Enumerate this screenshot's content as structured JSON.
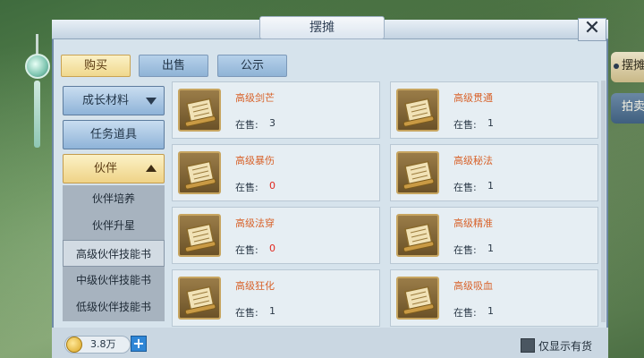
{
  "window": {
    "title": "摆摊",
    "close_symbol": "✕"
  },
  "tabs": [
    {
      "label": "购买",
      "active": true
    },
    {
      "label": "出售",
      "active": false
    },
    {
      "label": "公示",
      "active": false
    }
  ],
  "categories": [
    {
      "label": "成长材料",
      "expanded": false
    },
    {
      "label": "任务道具"
    },
    {
      "label": "伙伴",
      "expanded": true
    }
  ],
  "subcategories": [
    {
      "label": "伙伴培养",
      "selected": false
    },
    {
      "label": "伙伴升星",
      "selected": false
    },
    {
      "label": "高级伙伴技能书",
      "selected": true
    },
    {
      "label": "中级伙伴技能书",
      "selected": false
    },
    {
      "label": "低级伙伴技能书",
      "selected": false
    }
  ],
  "items": [
    {
      "name": "高级剑芒",
      "stock_label": "在售:",
      "stock": "3"
    },
    {
      "name": "高级贯通",
      "stock_label": "在售:",
      "stock": "1"
    },
    {
      "name": "高级暴伤",
      "stock_label": "在售:",
      "stock": "0"
    },
    {
      "name": "高级秘法",
      "stock_label": "在售:",
      "stock": "1"
    },
    {
      "name": "高级法穿",
      "stock_label": "在售:",
      "stock": "0"
    },
    {
      "name": "高级精准",
      "stock_label": "在售:",
      "stock": "1"
    },
    {
      "name": "高级狂化",
      "stock_label": "在售:",
      "stock": "1"
    },
    {
      "name": "高级吸血",
      "stock_label": "在售:",
      "stock": "1"
    }
  ],
  "currency": {
    "amount": "3.8万",
    "icon": "coin-icon",
    "add_symbol": "+"
  },
  "filter": {
    "label": "仅显示有货",
    "checked": false
  },
  "side_tabs": [
    {
      "label": "摆摊",
      "active": true
    },
    {
      "label": "拍卖",
      "active": false
    }
  ],
  "colors": {
    "item_name": "#d8622a",
    "zero_stock": "#e1281f",
    "active_tab": "#f0d88d",
    "accent_blue": "#2f86d6"
  }
}
